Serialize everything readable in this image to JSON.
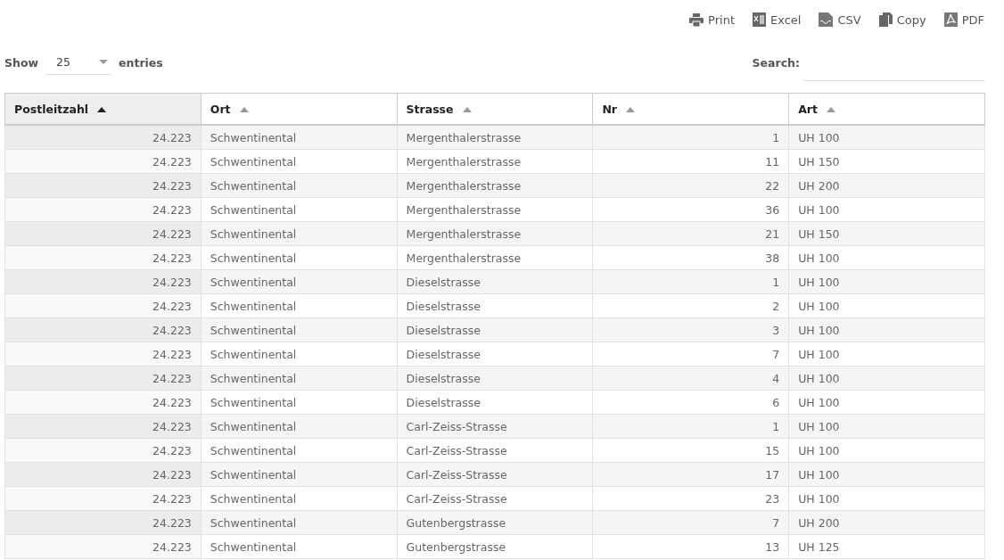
{
  "export_buttons": [
    {
      "kind": "print",
      "label": "Print"
    },
    {
      "kind": "excel",
      "label": "Excel"
    },
    {
      "kind": "csv",
      "label": "CSV"
    },
    {
      "kind": "copy",
      "label": "Copy"
    },
    {
      "kind": "pdf",
      "label": "PDF"
    }
  ],
  "length_control": {
    "prefix": "Show",
    "value": "25",
    "suffix": "entries"
  },
  "search": {
    "label": "Search:"
  },
  "table": {
    "columns": [
      {
        "label": "Postleitzahl",
        "selected": true,
        "kind": "number"
      },
      {
        "label": "Ort",
        "selected": false,
        "kind": "text"
      },
      {
        "label": "Strasse",
        "selected": false,
        "kind": "text"
      },
      {
        "label": "Nr",
        "selected": false,
        "kind": "number"
      },
      {
        "label": "Art",
        "selected": false,
        "kind": "text"
      }
    ],
    "rows": [
      [
        "24.223",
        "Schwentinental",
        "Mergenthalerstrasse",
        "1",
        "UH 100"
      ],
      [
        "24.223",
        "Schwentinental",
        "Mergenthalerstrasse",
        "11",
        "UH 150"
      ],
      [
        "24.223",
        "Schwentinental",
        "Mergenthalerstrasse",
        "22",
        "UH 200"
      ],
      [
        "24.223",
        "Schwentinental",
        "Mergenthalerstrasse",
        "36",
        "UH 100"
      ],
      [
        "24.223",
        "Schwentinental",
        "Mergenthalerstrasse",
        "21",
        "UH 150"
      ],
      [
        "24.223",
        "Schwentinental",
        "Mergenthalerstrasse",
        "38",
        "UH 100"
      ],
      [
        "24.223",
        "Schwentinental",
        "Dieselstrasse",
        "1",
        "UH 100"
      ],
      [
        "24.223",
        "Schwentinental",
        "Dieselstrasse",
        "2",
        "UH 100"
      ],
      [
        "24.223",
        "Schwentinental",
        "Dieselstrasse",
        "3",
        "UH 100"
      ],
      [
        "24.223",
        "Schwentinental",
        "Dieselstrasse",
        "7",
        "UH 100"
      ],
      [
        "24.223",
        "Schwentinental",
        "Dieselstrasse",
        "4",
        "UH 100"
      ],
      [
        "24.223",
        "Schwentinental",
        "Dieselstrasse",
        "6",
        "UH 100"
      ],
      [
        "24.223",
        "Schwentinental",
        "Carl-Zeiss-Strasse",
        "1",
        "UH 100"
      ],
      [
        "24.223",
        "Schwentinental",
        "Carl-Zeiss-Strasse",
        "15",
        "UH 100"
      ],
      [
        "24.223",
        "Schwentinental",
        "Carl-Zeiss-Strasse",
        "17",
        "UH 100"
      ],
      [
        "24.223",
        "Schwentinental",
        "Carl-Zeiss-Strasse",
        "23",
        "UH 100"
      ],
      [
        "24.223",
        "Schwentinental",
        "Gutenbergstrasse",
        "7",
        "UH 200"
      ],
      [
        "24.223",
        "Schwentinental",
        "Gutenbergstrasse",
        "13",
        "UH 125"
      ]
    ]
  }
}
